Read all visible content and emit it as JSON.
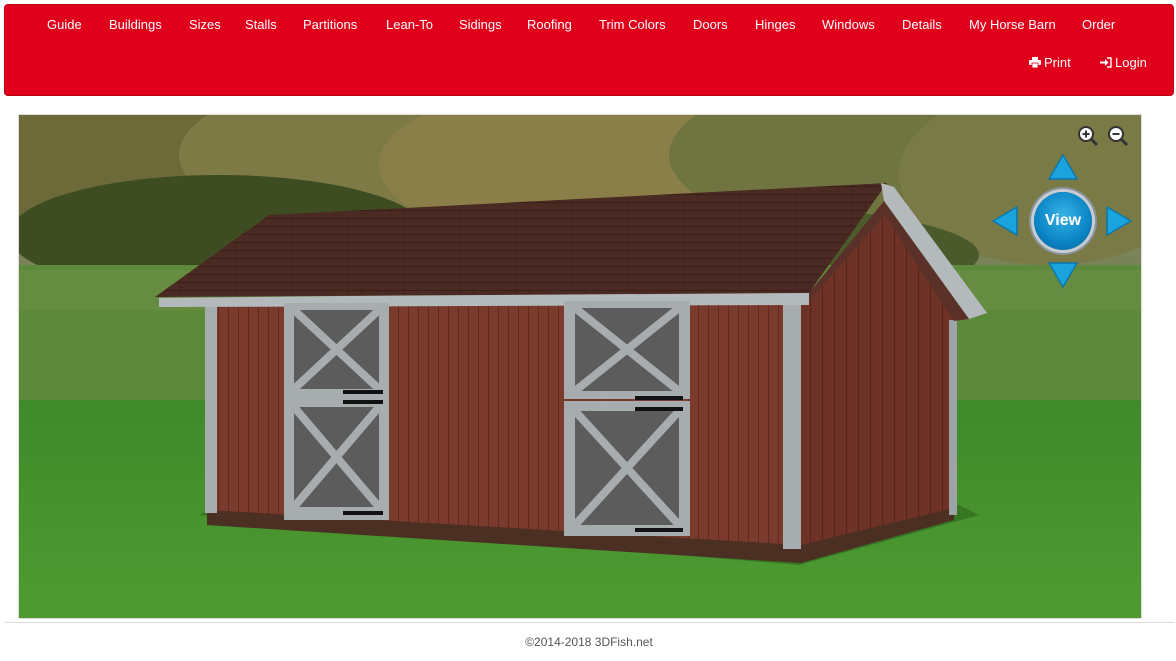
{
  "nav": {
    "items": [
      {
        "label": "Guide"
      },
      {
        "label": "Buildings"
      },
      {
        "label": "Sizes"
      },
      {
        "label": "Stalls"
      },
      {
        "label": "Partitions"
      },
      {
        "label": "Lean-To"
      },
      {
        "label": "Sidings"
      },
      {
        "label": "Roofing"
      },
      {
        "label": "Trim Colors"
      },
      {
        "label": "Doors"
      },
      {
        "label": "Hinges"
      },
      {
        "label": "Windows"
      },
      {
        "label": "Details"
      },
      {
        "label": "My Horse Barn"
      },
      {
        "label": "Order"
      }
    ],
    "print_label": "Print",
    "login_label": "Login",
    "print_icon": "printer-icon",
    "login_icon": "sign-in-icon",
    "background_color": "#e0001b"
  },
  "viewer": {
    "view_button_label": "View",
    "controls": [
      "zoom-in-icon",
      "zoom-out-icon",
      "arrow-up-icon",
      "arrow-left-icon",
      "arrow-right-icon",
      "arrow-down-icon"
    ],
    "accent_color": "#0a84c4"
  },
  "footer": {
    "copyright": "©2014-2018 3DFish.net"
  }
}
